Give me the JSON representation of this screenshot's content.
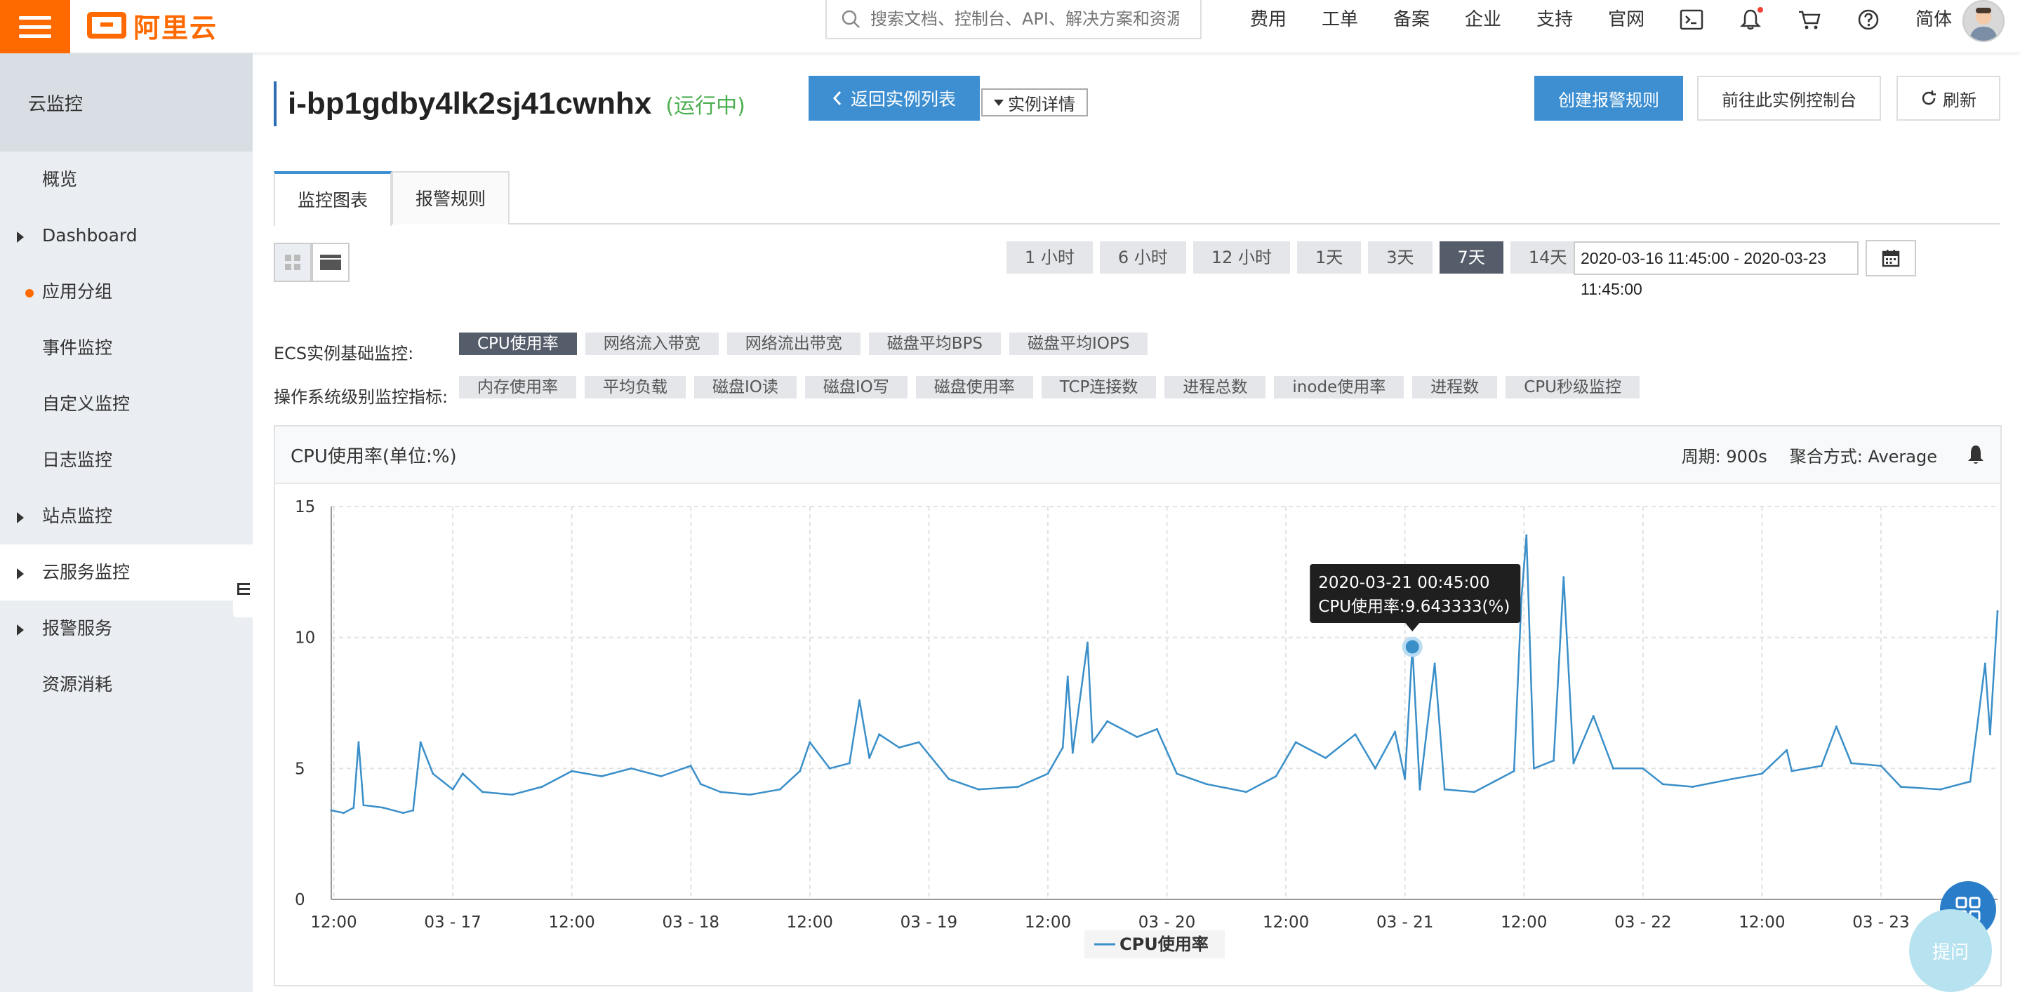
{
  "header": {
    "logo_text": "阿里云",
    "search_placeholder": "搜索文档、控制台、API、解决方案和资源",
    "nav": [
      "费用",
      "工单",
      "备案",
      "企业",
      "支持",
      "官网"
    ],
    "lang": "简体"
  },
  "sidebar": {
    "title": "云监控",
    "items": [
      {
        "label": "概览",
        "marker": "none"
      },
      {
        "label": "Dashboard",
        "marker": "caret"
      },
      {
        "label": "应用分组",
        "marker": "dot"
      },
      {
        "label": "事件监控",
        "marker": "none"
      },
      {
        "label": "自定义监控",
        "marker": "none"
      },
      {
        "label": "日志监控",
        "marker": "none"
      },
      {
        "label": "站点监控",
        "marker": "caret"
      },
      {
        "label": "云服务监控",
        "marker": "caret"
      },
      {
        "label": "报警服务",
        "marker": "caret"
      },
      {
        "label": "资源消耗",
        "marker": "none"
      }
    ]
  },
  "instance": {
    "id": "i-bp1gdby4lk2sj41cwnhx",
    "status": "(运行中)"
  },
  "actions": {
    "back": "返回实例列表",
    "detail": "实例详情",
    "create_rule": "创建报警规则",
    "goto_console": "前往此实例控制台",
    "refresh": "刷新"
  },
  "tabs": [
    "监控图表",
    "报警规则"
  ],
  "time_ranges": [
    "1 小时",
    "6 小时",
    "12 小时",
    "1天",
    "3天",
    "7天",
    "14天"
  ],
  "selected_range": "7天",
  "date_range": "2020-03-16 11:45:00 - 2020-03-23 11:45:00",
  "metrics": {
    "basic_label": "ECS实例基础监控:",
    "basic": [
      "CPU使用率",
      "网络流入带宽",
      "网络流出带宽",
      "磁盘平均BPS",
      "磁盘平均IOPS"
    ],
    "basic_selected": "CPU使用率",
    "os_label": "操作系统级别监控指标:",
    "os": [
      "内存使用率",
      "平均负载",
      "磁盘IO读",
      "磁盘IO写",
      "磁盘使用率",
      "TCP连接数",
      "进程总数",
      "inode使用率",
      "进程数",
      "CPU秒级监控"
    ]
  },
  "chart_panel": {
    "title": "CPU使用率(单位:%)",
    "period": "周期: 900s",
    "aggregation": "聚合方式: Average"
  },
  "chart_data": {
    "type": "line",
    "title": "CPU使用率(单位:%)",
    "x_tick_labels": [
      "12:00",
      "03 - 17",
      "12:00",
      "03 - 18",
      "12:00",
      "03 - 19",
      "12:00",
      "03 - 20",
      "12:00",
      "03 - 21",
      "12:00",
      "03 - 22",
      "12:00",
      "03 - 23"
    ],
    "x_range": [
      "2020-03-16 11:45",
      "2020-03-23 11:45"
    ],
    "ylim": [
      0,
      15
    ],
    "y_ticks": [
      0,
      5,
      10,
      15
    ],
    "grid": true,
    "legend_position": "bottom-center",
    "series": [
      {
        "name": "CPU使用率",
        "color": "#3a8fc9",
        "points": [
          [
            "2020-03-16 11:45",
            3.4
          ],
          [
            "2020-03-16 13:00",
            3.3
          ],
          [
            "2020-03-16 14:00",
            3.5
          ],
          [
            "2020-03-16 14:30",
            6.0
          ],
          [
            "2020-03-16 15:00",
            3.6
          ],
          [
            "2020-03-16 17:00",
            3.5
          ],
          [
            "2020-03-16 19:00",
            3.3
          ],
          [
            "2020-03-16 20:00",
            3.4
          ],
          [
            "2020-03-16 20:45",
            6.0
          ],
          [
            "2020-03-16 22:00",
            4.8
          ],
          [
            "2020-03-17 00:00",
            4.2
          ],
          [
            "2020-03-17 01:00",
            4.8
          ],
          [
            "2020-03-17 03:00",
            4.1
          ],
          [
            "2020-03-17 06:00",
            4.0
          ],
          [
            "2020-03-17 09:00",
            4.3
          ],
          [
            "2020-03-17 12:00",
            4.9
          ],
          [
            "2020-03-17 15:00",
            4.7
          ],
          [
            "2020-03-17 18:00",
            5.0
          ],
          [
            "2020-03-17 21:00",
            4.7
          ],
          [
            "2020-03-18 00:00",
            5.1
          ],
          [
            "2020-03-18 01:00",
            4.4
          ],
          [
            "2020-03-18 03:00",
            4.1
          ],
          [
            "2020-03-18 06:00",
            4.0
          ],
          [
            "2020-03-18 09:00",
            4.2
          ],
          [
            "2020-03-18 11:00",
            4.9
          ],
          [
            "2020-03-18 12:00",
            6.0
          ],
          [
            "2020-03-18 14:00",
            5.0
          ],
          [
            "2020-03-18 16:00",
            5.2
          ],
          [
            "2020-03-18 17:00",
            7.6
          ],
          [
            "2020-03-18 18:00",
            5.4
          ],
          [
            "2020-03-18 19:00",
            6.3
          ],
          [
            "2020-03-18 21:00",
            5.8
          ],
          [
            "2020-03-18 23:00",
            6.0
          ],
          [
            "2020-03-19 02:00",
            4.6
          ],
          [
            "2020-03-19 05:00",
            4.2
          ],
          [
            "2020-03-19 09:00",
            4.3
          ],
          [
            "2020-03-19 12:00",
            4.8
          ],
          [
            "2020-03-19 13:30",
            5.8
          ],
          [
            "2020-03-19 14:00",
            8.5
          ],
          [
            "2020-03-19 14:30",
            5.6
          ],
          [
            "2020-03-19 16:00",
            9.8
          ],
          [
            "2020-03-19 16:30",
            6.0
          ],
          [
            "2020-03-19 18:00",
            6.8
          ],
          [
            "2020-03-19 21:00",
            6.2
          ],
          [
            "2020-03-19 23:00",
            6.5
          ],
          [
            "2020-03-20 01:00",
            4.8
          ],
          [
            "2020-03-20 04:00",
            4.4
          ],
          [
            "2020-03-20 08:00",
            4.1
          ],
          [
            "2020-03-20 11:00",
            4.7
          ],
          [
            "2020-03-20 13:00",
            6.0
          ],
          [
            "2020-03-20 16:00",
            5.4
          ],
          [
            "2020-03-20 19:00",
            6.3
          ],
          [
            "2020-03-20 21:00",
            5.0
          ],
          [
            "2020-03-20 23:00",
            6.4
          ],
          [
            "2020-03-21 00:00",
            4.6
          ],
          [
            "2020-03-21 00:45",
            9.643333
          ],
          [
            "2020-03-21 01:30",
            4.2
          ],
          [
            "2020-03-21 03:00",
            9.0
          ],
          [
            "2020-03-21 04:00",
            4.2
          ],
          [
            "2020-03-21 07:00",
            4.1
          ],
          [
            "2020-03-21 09:00",
            4.5
          ],
          [
            "2020-03-21 11:00",
            4.9
          ],
          [
            "2020-03-21 11:45",
            11.5
          ],
          [
            "2020-03-21 12:15",
            13.9
          ],
          [
            "2020-03-21 13:00",
            5.0
          ],
          [
            "2020-03-21 15:00",
            5.3
          ],
          [
            "2020-03-21 16:00",
            12.3
          ],
          [
            "2020-03-21 17:00",
            5.2
          ],
          [
            "2020-03-21 19:00",
            7.0
          ],
          [
            "2020-03-21 21:00",
            5.0
          ],
          [
            "2020-03-22 00:00",
            5.0
          ],
          [
            "2020-03-22 02:00",
            4.4
          ],
          [
            "2020-03-22 05:00",
            4.3
          ],
          [
            "2020-03-22 09:00",
            4.6
          ],
          [
            "2020-03-22 12:00",
            4.8
          ],
          [
            "2020-03-22 14:30",
            5.7
          ],
          [
            "2020-03-22 15:00",
            4.9
          ],
          [
            "2020-03-22 18:00",
            5.1
          ],
          [
            "2020-03-22 19:30",
            6.6
          ],
          [
            "2020-03-22 21:00",
            5.2
          ],
          [
            "2020-03-23 00:00",
            5.1
          ],
          [
            "2020-03-23 02:00",
            4.3
          ],
          [
            "2020-03-23 06:00",
            4.2
          ],
          [
            "2020-03-23 09:00",
            4.5
          ],
          [
            "2020-03-23 10:30",
            9.0
          ],
          [
            "2020-03-23 11:00",
            6.3
          ],
          [
            "2020-03-23 11:45",
            11.0
          ]
        ]
      }
    ],
    "tooltip": {
      "time": "2020-03-21 00:45:00",
      "text": "CPU使用率:9.643333(%)",
      "value": 9.643333
    }
  },
  "float_buttons": {
    "ask": "提问"
  }
}
